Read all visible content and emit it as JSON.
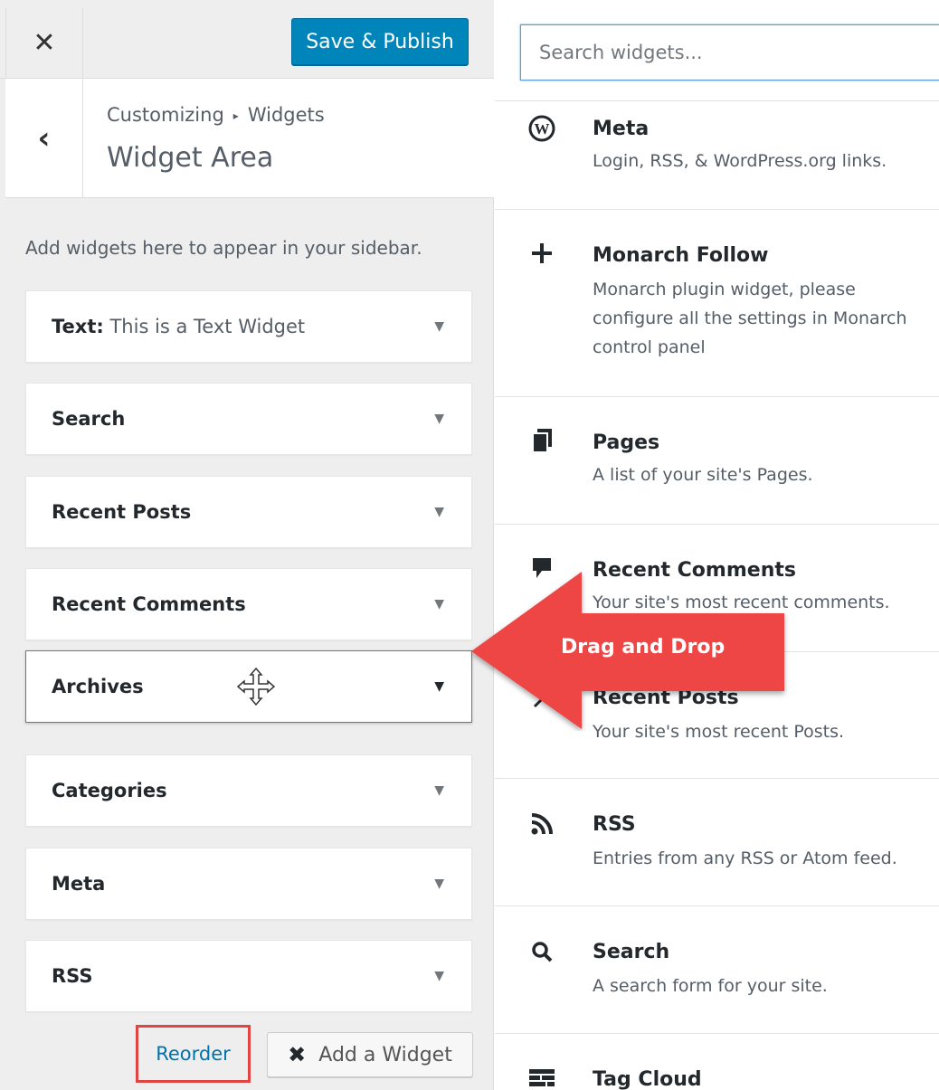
{
  "topbar": {
    "close_label": "✕",
    "save_label": "Save & Publish"
  },
  "header": {
    "back_label": "‹",
    "breadcrumb_root": "Customizing",
    "breadcrumb_sep": "▸",
    "breadcrumb_current": "Widgets",
    "title": "Widget Area"
  },
  "sidebar": {
    "description": "Add widgets here to appear in your sidebar.",
    "widgets": [
      {
        "title": "Text",
        "subtitle": "This is a Text Widget"
      },
      {
        "title": "Search",
        "subtitle": ""
      },
      {
        "title": "Recent Posts",
        "subtitle": ""
      },
      {
        "title": "Recent Comments",
        "subtitle": ""
      },
      {
        "title": "Archives",
        "subtitle": ""
      },
      {
        "title": "Categories",
        "subtitle": ""
      },
      {
        "title": "Meta",
        "subtitle": ""
      },
      {
        "title": "RSS",
        "subtitle": ""
      }
    ],
    "arrow_glyph": "▼",
    "reorder_label": "Reorder",
    "add_widget_label": "Add a Widget",
    "add_widget_icon": "✖"
  },
  "available": {
    "search_placeholder": "Search widgets...",
    "items": [
      {
        "icon": "wordpress-icon",
        "title": "Meta",
        "desc": "Login, RSS, & WordPress.org links."
      },
      {
        "icon": "plus-icon",
        "title": "Monarch Follow",
        "desc": "Monarch plugin widget, please configure all the settings in Monarch control panel"
      },
      {
        "icon": "pages-icon",
        "title": "Pages",
        "desc": "A list of your site's Pages."
      },
      {
        "icon": "comment-icon",
        "title": "Recent Comments",
        "desc": "Your site's most recent comments."
      },
      {
        "icon": "pin-icon",
        "title": "Recent Posts",
        "desc": "Your site's most recent Posts."
      },
      {
        "icon": "rss-icon",
        "title": "RSS",
        "desc": "Entries from any RSS or Atom feed."
      },
      {
        "icon": "search-icon",
        "title": "Search",
        "desc": "A search form for your site."
      },
      {
        "icon": "tag-cloud-icon",
        "title": "Tag Cloud",
        "desc": ""
      }
    ]
  },
  "overlay": {
    "arrow_label": "Drag and Drop",
    "arrow_color": "#ee4444"
  },
  "colors": {
    "primary_button": "#0085ba",
    "link": "#0073aa",
    "highlight_box": "#e04545"
  }
}
